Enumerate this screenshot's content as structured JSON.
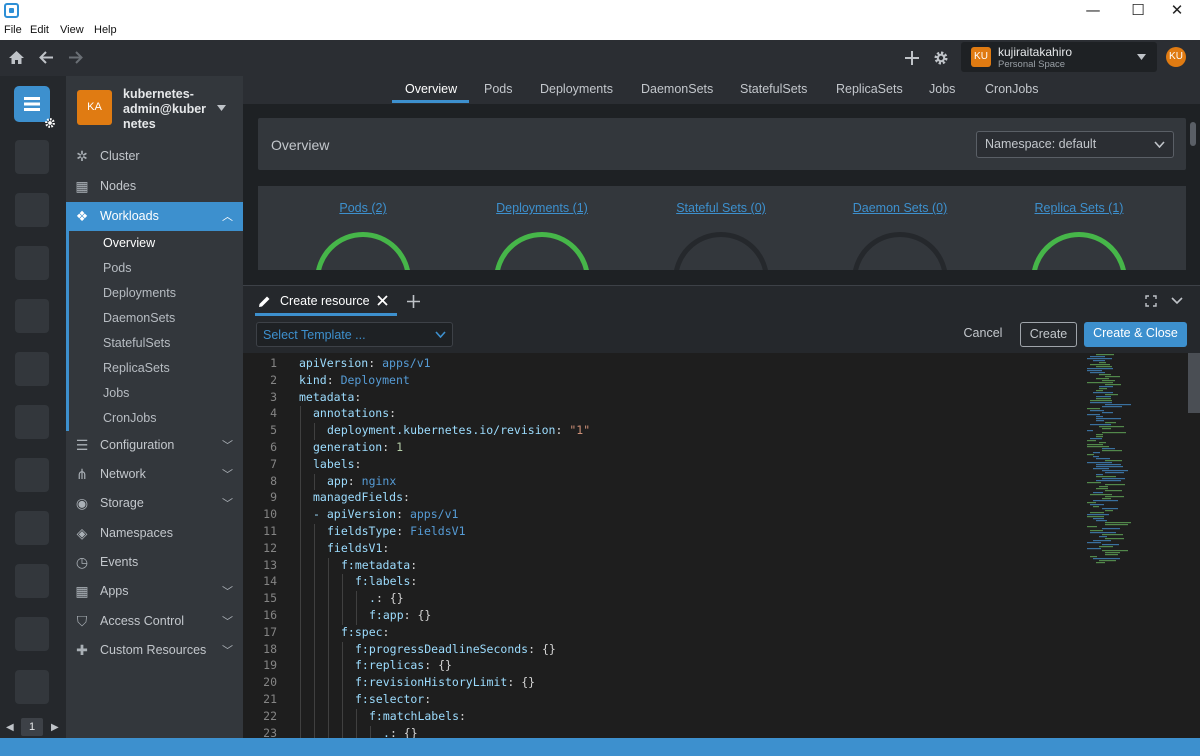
{
  "window": {
    "min_glyph": "—",
    "max_glyph": "☐",
    "close_glyph": "✕"
  },
  "menu": [
    "File",
    "Edit",
    "View",
    "Help"
  ],
  "toolbar": {
    "user": {
      "initials": "KU",
      "name": "kujiraitakahiro",
      "space": "Personal Space"
    }
  },
  "hotbar": {
    "page": "1"
  },
  "sidebar": {
    "cluster": {
      "initials": "KA",
      "name_line1": "kubernetes-",
      "name_line2": "admin@kuber",
      "name_line3": "netes"
    },
    "items": [
      {
        "label": "Cluster",
        "icon": "helm-wheel-icon",
        "glyph": "✲"
      },
      {
        "label": "Nodes",
        "icon": "nodes-icon",
        "glyph": "▦"
      },
      {
        "label": "Workloads",
        "icon": "workloads-icon",
        "glyph": "❖"
      },
      {
        "label": "Configuration",
        "icon": "list-icon",
        "glyph": "☰"
      },
      {
        "label": "Network",
        "icon": "network-icon",
        "glyph": "⋔"
      },
      {
        "label": "Storage",
        "icon": "storage-icon",
        "glyph": "◉"
      },
      {
        "label": "Namespaces",
        "icon": "layers-icon",
        "glyph": "◈"
      },
      {
        "label": "Events",
        "icon": "clock-icon",
        "glyph": "◷"
      },
      {
        "label": "Apps",
        "icon": "apps-grid-icon",
        "glyph": "▦"
      },
      {
        "label": "Access Control",
        "icon": "shield-icon",
        "glyph": "⛉"
      },
      {
        "label": "Custom Resources",
        "icon": "puzzle-icon",
        "glyph": "✚"
      }
    ],
    "workload_sub": [
      "Overview",
      "Pods",
      "Deployments",
      "DaemonSets",
      "StatefulSets",
      "ReplicaSets",
      "Jobs",
      "CronJobs"
    ]
  },
  "tabs": [
    "Overview",
    "Pods",
    "Deployments",
    "DaemonSets",
    "StatefulSets",
    "ReplicaSets",
    "Jobs",
    "CronJobs"
  ],
  "overview": {
    "title": "Overview",
    "namespace": "Namespace: default",
    "charts": [
      {
        "label": "Pods (2)",
        "filled": true
      },
      {
        "label": "Deployments (1)",
        "filled": true
      },
      {
        "label": "Stateful Sets (0)",
        "filled": false
      },
      {
        "label": "Daemon Sets (0)",
        "filled": false
      },
      {
        "label": "Replica Sets (1)",
        "filled": true
      }
    ]
  },
  "dock": {
    "tab_label": "Create resource",
    "template_placeholder": "Select Template ...",
    "cancel": "Cancel",
    "create": "Create",
    "create_close": "Create & Close"
  },
  "editor": {
    "lines": [
      {
        "n": "1",
        "indent": 0,
        "key": "apiVersion",
        "val": "apps/v1",
        "type": "v"
      },
      {
        "n": "2",
        "indent": 0,
        "key": "kind",
        "val": "Deployment",
        "type": "v"
      },
      {
        "n": "3",
        "indent": 0,
        "key": "metadata",
        "val": "",
        "type": ""
      },
      {
        "n": "4",
        "indent": 1,
        "key": "annotations",
        "val": "",
        "type": ""
      },
      {
        "n": "5",
        "indent": 2,
        "key": "deployment.kubernetes.io/revision",
        "val": "\"1\"",
        "type": "s"
      },
      {
        "n": "6",
        "indent": 1,
        "key": "generation",
        "val": "1",
        "type": "n"
      },
      {
        "n": "7",
        "indent": 1,
        "key": "labels",
        "val": "",
        "type": ""
      },
      {
        "n": "8",
        "indent": 2,
        "key": "app",
        "val": "nginx",
        "type": "v"
      },
      {
        "n": "9",
        "indent": 1,
        "key": "managedFields",
        "val": "",
        "type": ""
      },
      {
        "n": "10",
        "indent": 1,
        "key": "- apiVersion",
        "val": "apps/v1",
        "type": "v"
      },
      {
        "n": "11",
        "indent": 2,
        "key": "fieldsType",
        "val": "FieldsV1",
        "type": "v"
      },
      {
        "n": "12",
        "indent": 2,
        "key": "fieldsV1",
        "val": "",
        "type": ""
      },
      {
        "n": "13",
        "indent": 3,
        "key": "f:metadata",
        "val": "",
        "type": ""
      },
      {
        "n": "14",
        "indent": 4,
        "key": "f:labels",
        "val": "",
        "type": ""
      },
      {
        "n": "15",
        "indent": 5,
        "key": ".",
        "val": "{}",
        "type": "p"
      },
      {
        "n": "16",
        "indent": 5,
        "key": "f:app",
        "val": "{}",
        "type": "p"
      },
      {
        "n": "17",
        "indent": 3,
        "key": "f:spec",
        "val": "",
        "type": ""
      },
      {
        "n": "18",
        "indent": 4,
        "key": "f:progressDeadlineSeconds",
        "val": "{}",
        "type": "p"
      },
      {
        "n": "19",
        "indent": 4,
        "key": "f:replicas",
        "val": "{}",
        "type": "p"
      },
      {
        "n": "20",
        "indent": 4,
        "key": "f:revisionHistoryLimit",
        "val": "{}",
        "type": "p"
      },
      {
        "n": "21",
        "indent": 4,
        "key": "f:selector",
        "val": "",
        "type": ""
      },
      {
        "n": "22",
        "indent": 5,
        "key": "f:matchLabels",
        "val": "",
        "type": ""
      },
      {
        "n": "23",
        "indent": 6,
        "key": ".",
        "val": "{}",
        "type": "p"
      }
    ]
  },
  "colors": {
    "accent": "#3d90ce",
    "ring_filled": "#46b649",
    "ring_empty": "#25282c",
    "avatar": "#e07b12"
  }
}
